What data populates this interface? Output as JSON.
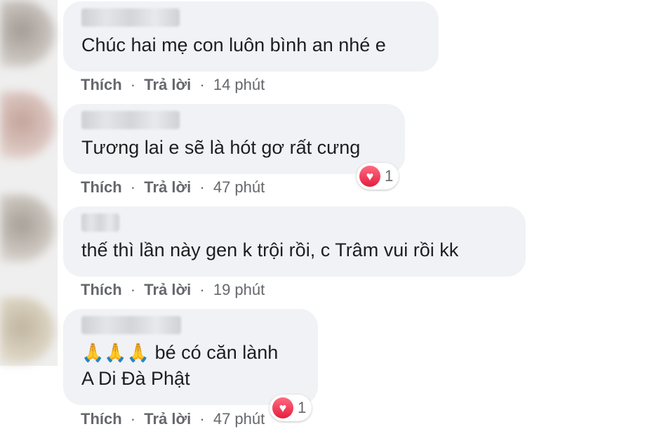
{
  "comments": [
    {
      "text": "Chúc hai mẹ con luôn bình an nhé e",
      "like": "Thích",
      "reply": "Trả lời",
      "dot": "·",
      "time": "14 phút"
    },
    {
      "text": "Tương lai e sẽ là hót gơ rất cưng",
      "like": "Thích",
      "reply": "Trả lời",
      "dot": "·",
      "time": "47 phút",
      "reaction_count": "1"
    },
    {
      "text": "thế thì lần này gen k trội rồi, c Trâm vui rồi kk",
      "like": "Thích",
      "reply": "Trả lời",
      "dot": "·",
      "time": "19 phút"
    },
    {
      "emoji": "🙏🙏🙏",
      "text_line1": "bé có căn lành",
      "text_line2": "A Di Đà Phật",
      "like": "Thích",
      "reply": "Trả lời",
      "dot": "·",
      "time": "47 phút",
      "reaction_count": "1"
    }
  ],
  "icons": {
    "reaction": "heart-icon",
    "emoji": "folded-hands"
  },
  "colors": {
    "bubble": "#f0f2f5",
    "text": "#1c1e21",
    "meta": "#65676b",
    "heart": "#e41e3f"
  }
}
